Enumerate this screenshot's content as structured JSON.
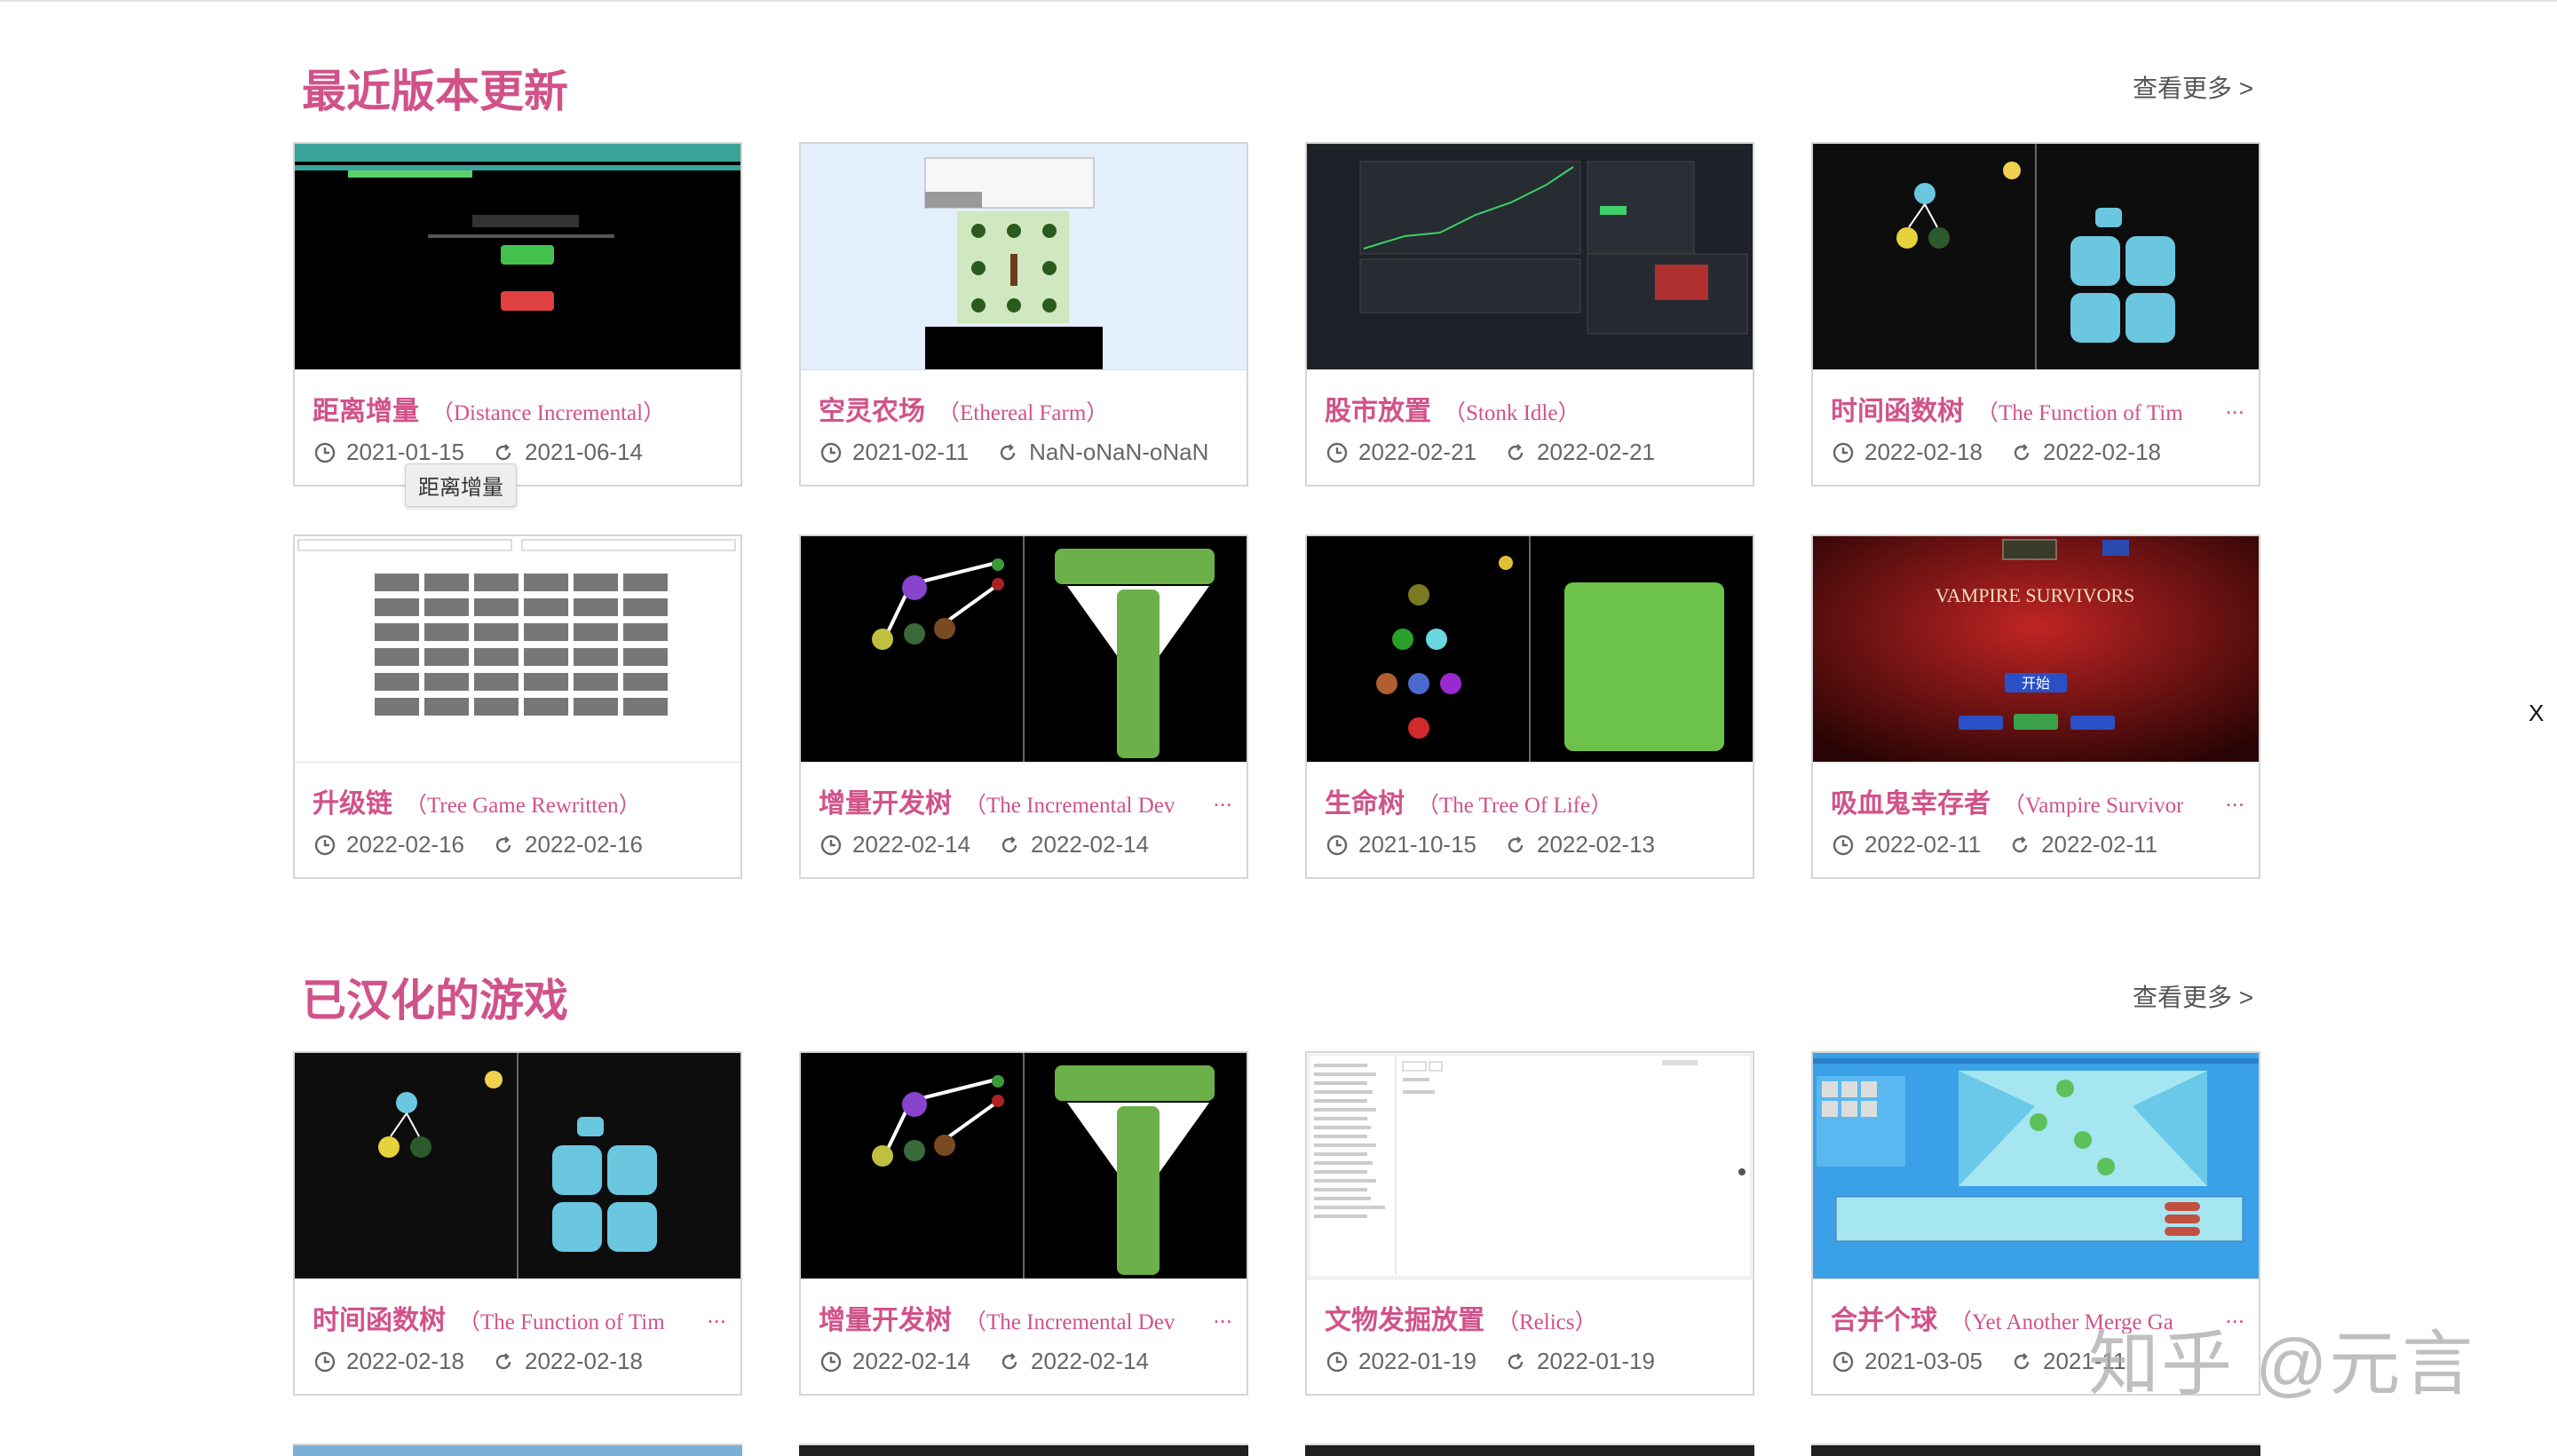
{
  "sections": [
    {
      "title": "最近版本更新",
      "more": "查看更多 >"
    },
    {
      "title": "已汉化的游戏",
      "more": "查看更多 >"
    }
  ],
  "cards": [
    {
      "cn": "距离增量",
      "en": "（Distance Incremental）",
      "created": "2021-01-15",
      "updated": "2021-06-14",
      "truncated": false
    },
    {
      "cn": "空灵农场",
      "en": "（Ethereal Farm）",
      "created": "2021-02-11",
      "updated": "NaN-oNaN-oNaN",
      "truncated": false
    },
    {
      "cn": "股市放置",
      "en": "（Stonk Idle）",
      "created": "2022-02-21",
      "updated": "2022-02-21",
      "truncated": false
    },
    {
      "cn": "时间函数树",
      "en": "（The Function of Tim",
      "created": "2022-02-18",
      "updated": "2022-02-18",
      "truncated": true
    },
    {
      "cn": "升级链",
      "en": "（Tree Game Rewritten）",
      "created": "2022-02-16",
      "updated": "2022-02-16",
      "truncated": false
    },
    {
      "cn": "增量开发树",
      "en": "（The Incremental Dev",
      "created": "2022-02-14",
      "updated": "2022-02-14",
      "truncated": true
    },
    {
      "cn": "生命树",
      "en": "（The Tree Of Life）",
      "created": "2021-10-15",
      "updated": "2022-02-13",
      "truncated": false
    },
    {
      "cn": "吸血鬼幸存者",
      "en": "（Vampire Survivor",
      "created": "2022-02-11",
      "updated": "2022-02-11",
      "truncated": true
    },
    {
      "cn": "时间函数树",
      "en": "（The Function of Tim",
      "created": "2022-02-18",
      "updated": "2022-02-18",
      "truncated": true
    },
    {
      "cn": "增量开发树",
      "en": "（The Incremental Dev",
      "created": "2022-02-14",
      "updated": "2022-02-14",
      "truncated": true
    },
    {
      "cn": "文物发掘放置",
      "en": "（Relics）",
      "created": "2022-01-19",
      "updated": "2022-01-19",
      "truncated": false
    },
    {
      "cn": "合并个球",
      "en": "（Yet Another Merge Ga",
      "created": "2021-03-05",
      "updated": "2021-11",
      "truncated": true
    }
  ],
  "dots": "...",
  "tooltip": "距离增量",
  "close_label": "X",
  "watermark": "知乎 @元言",
  "thumb_labels": {
    "vampire_title": "VAMPIRE SURVIVORS",
    "vampire_start": "开始"
  },
  "colors": {
    "accent": "#d1528a",
    "text_muted": "#666666",
    "border": "#d5d5d5"
  },
  "icons": {
    "created": "clock-icon",
    "updated": "refresh-icon"
  }
}
